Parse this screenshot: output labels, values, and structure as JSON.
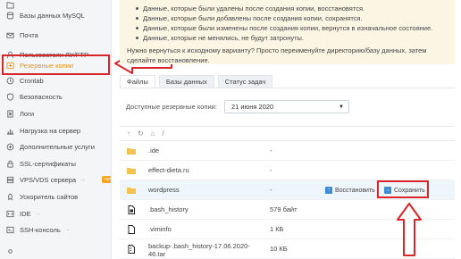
{
  "sidebar": {
    "items": [
      {
        "label": "",
        "icon": "folder-icon"
      },
      {
        "label": "Базы данных MySQL",
        "icon": "database-icon"
      },
      {
        "label": "Почта",
        "icon": "mail-icon"
      },
      {
        "label": "Пользователи ЛУ/FTP",
        "icon": "users-icon"
      },
      {
        "label": "Резервные копии",
        "icon": "backup-icon",
        "active": true
      },
      {
        "label": "Crontab",
        "icon": "clock-icon"
      },
      {
        "label": "Безопасность",
        "icon": "shield-icon"
      },
      {
        "label": "Логи",
        "icon": "log-icon"
      },
      {
        "label": "Нагрузка на сервер",
        "icon": "chart-icon"
      },
      {
        "label": "Дополнительные услуги",
        "icon": "plus-icon"
      },
      {
        "label": "SSL-сертификаты",
        "icon": "lock-icon"
      },
      {
        "label": "VPS/VDS сервера",
        "icon": "server-icon",
        "arrow": "→",
        "badge": "new"
      },
      {
        "label": "Ускоритель сайтов",
        "icon": "rocket-icon"
      },
      {
        "label": "IDE",
        "icon": "code-icon",
        "arrow": "→"
      },
      {
        "label": "SSH-консоль",
        "icon": "terminal-icon",
        "arrow": "→"
      }
    ],
    "accent_color": "#e1931c"
  },
  "notice": {
    "bullets": [
      "Данные, которые были удалены после создания копии, восстановятся.",
      "Данные, которые были добавлены после создания копии, сохранятся.",
      "Данные, которые были изменены после создания копии, вернутся в изначальное состояние.",
      "Данные, которые не менялись, не будут затронуты."
    ],
    "text": "Нужно вернуться к исходному варианту? Просто переименуйте директорию/базу данных, затем сделайте восстановление."
  },
  "tabs": [
    {
      "label": "Файлы",
      "selected": true
    },
    {
      "label": "Базы данных",
      "selected": false
    },
    {
      "label": "Статус задач",
      "selected": false
    }
  ],
  "backups": {
    "label": "Доступные резервные копии:",
    "selected": "21 июня 2020"
  },
  "toolbar": {
    "up": "↑",
    "refresh": "↻",
    "home": "⌂",
    "path": "/"
  },
  "files": [
    {
      "name": ".ide",
      "size": "-",
      "type": "folder"
    },
    {
      "name": "effect-dieta.ru",
      "size": "-",
      "type": "folder"
    },
    {
      "name": "wordpress",
      "size": "-",
      "type": "folder",
      "highlighted": true
    },
    {
      "name": ".bash_history",
      "size": "579 байт",
      "type": "file"
    },
    {
      "name": ".viminfo",
      "size": "1 КБ",
      "type": "file"
    },
    {
      "name": "backup-.bash_history-17.06.2020-\n46.tar",
      "size": "10 КБ",
      "type": "file"
    }
  ],
  "actions": {
    "restore": "Восстановить",
    "save": "Сохранить"
  },
  "annotation_color": "#d9262b"
}
